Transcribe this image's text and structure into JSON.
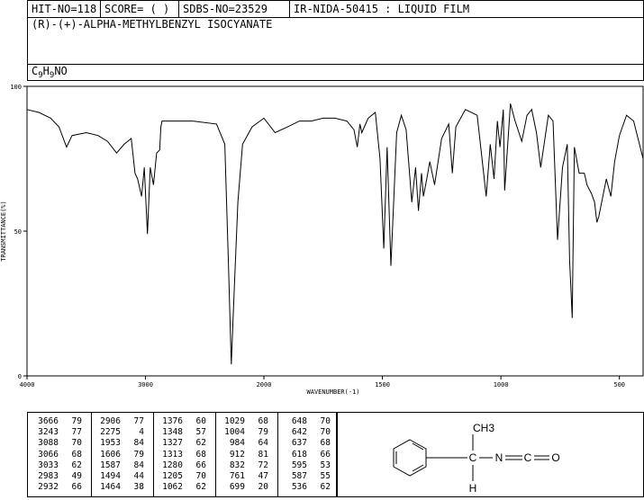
{
  "header": {
    "hit_no": "HIT-NO=118",
    "score": "SCORE=  (   )",
    "sdbs_no": "SDBS-NO=23529",
    "ir_code": "IR-NIDA-50415 : LIQUID FILM",
    "compound_name": "(R)-(+)-ALPHA-METHYLBENZYL ISOCYANATE",
    "formula_parts": {
      "c": "C",
      "c_n": "9",
      "h": "H",
      "h_n": "9",
      "rest": "NO"
    }
  },
  "chart_data": {
    "type": "line",
    "title": "",
    "xlabel": "WAVENUMBER(-1)",
    "ylabel": "TRANSMITTANCE(%)",
    "xlim": [
      4000,
      400
    ],
    "ylim": [
      0,
      100
    ],
    "x_ticks": [
      "4000",
      "3000",
      "2000",
      "1500",
      "1000",
      "500"
    ],
    "y_ticks": [
      "100",
      "50",
      "0"
    ],
    "series": [
      {
        "x": [
          4000,
          3900,
          3800,
          3730,
          3666,
          3620,
          3500,
          3400,
          3320,
          3243,
          3180,
          3120,
          3088,
          3066,
          3033,
          3010,
          2983,
          2960,
          2932,
          2906,
          2880,
          2870,
          2860,
          2800,
          2600,
          2400,
          2330,
          2300,
          2275,
          2250,
          2220,
          2180,
          2100,
          2000,
          1953,
          1900,
          1850,
          1800,
          1750,
          1700,
          1650,
          1620,
          1606,
          1595,
          1587,
          1560,
          1530,
          1510,
          1494,
          1480,
          1464,
          1440,
          1420,
          1400,
          1376,
          1360,
          1348,
          1335,
          1327,
          1313,
          1300,
          1280,
          1250,
          1220,
          1205,
          1190,
          1150,
          1100,
          1062,
          1045,
          1029,
          1015,
          1004,
          990,
          984,
          960,
          940,
          912,
          890,
          870,
          850,
          832,
          800,
          780,
          761,
          740,
          720,
          710,
          699,
          690,
          670,
          648,
          642,
          637,
          618,
          605,
          595,
          587,
          570,
          555,
          536,
          520,
          500,
          470,
          440,
          400
        ],
        "y": [
          92,
          91,
          89,
          86,
          79,
          83,
          84,
          83,
          81,
          77,
          80,
          82,
          70,
          68,
          62,
          72,
          49,
          72,
          66,
          77,
          78,
          86,
          88,
          88,
          88,
          87,
          80,
          40,
          4,
          30,
          60,
          80,
          86,
          89,
          84,
          86,
          88,
          88,
          89,
          89,
          88,
          85,
          79,
          87,
          84,
          89,
          91,
          75,
          44,
          79,
          38,
          84,
          90,
          85,
          60,
          72,
          57,
          70,
          62,
          68,
          74,
          66,
          82,
          87,
          70,
          86,
          92,
          90,
          62,
          80,
          68,
          88,
          79,
          92,
          64,
          94,
          88,
          81,
          90,
          92,
          84,
          72,
          90,
          88,
          47,
          72,
          80,
          40,
          20,
          79,
          70,
          70,
          68,
          66,
          63,
          60,
          53,
          55,
          62,
          68,
          62,
          74,
          83,
          90,
          88,
          75
        ]
      }
    ],
    "grid": false,
    "peak_table": [
      [
        [
          "3666",
          "79"
        ],
        [
          "3243",
          "77"
        ],
        [
          "3088",
          "70"
        ],
        [
          "3066",
          "68"
        ],
        [
          "3033",
          "62"
        ],
        [
          "2983",
          "49"
        ],
        [
          "2932",
          "66"
        ]
      ],
      [
        [
          "2906",
          "77"
        ],
        [
          "2275",
          "4"
        ],
        [
          "1953",
          "84"
        ],
        [
          "1606",
          "79"
        ],
        [
          "1587",
          "84"
        ],
        [
          "1494",
          "44"
        ],
        [
          "1464",
          "38"
        ]
      ],
      [
        [
          "1376",
          "60"
        ],
        [
          "1348",
          "57"
        ],
        [
          "1327",
          "62"
        ],
        [
          "1313",
          "68"
        ],
        [
          "1280",
          "66"
        ],
        [
          "1205",
          "70"
        ],
        [
          "1062",
          "62"
        ]
      ],
      [
        [
          "1029",
          "68"
        ],
        [
          "1004",
          "79"
        ],
        [
          "984",
          "64"
        ],
        [
          "912",
          "81"
        ],
        [
          "832",
          "72"
        ],
        [
          "761",
          "47"
        ],
        [
          "699",
          "20"
        ]
      ],
      [
        [
          "648",
          "70"
        ],
        [
          "642",
          "70"
        ],
        [
          "637",
          "68"
        ],
        [
          "618",
          "66"
        ],
        [
          "595",
          "53"
        ],
        [
          "587",
          "55"
        ],
        [
          "536",
          "62"
        ]
      ]
    ]
  },
  "structure": {
    "labels": {
      "methyl": "CH3",
      "carbon": "C",
      "hydrogen": "H",
      "nitrogen": "N",
      "carbon2": "C",
      "oxygen": "O"
    }
  }
}
